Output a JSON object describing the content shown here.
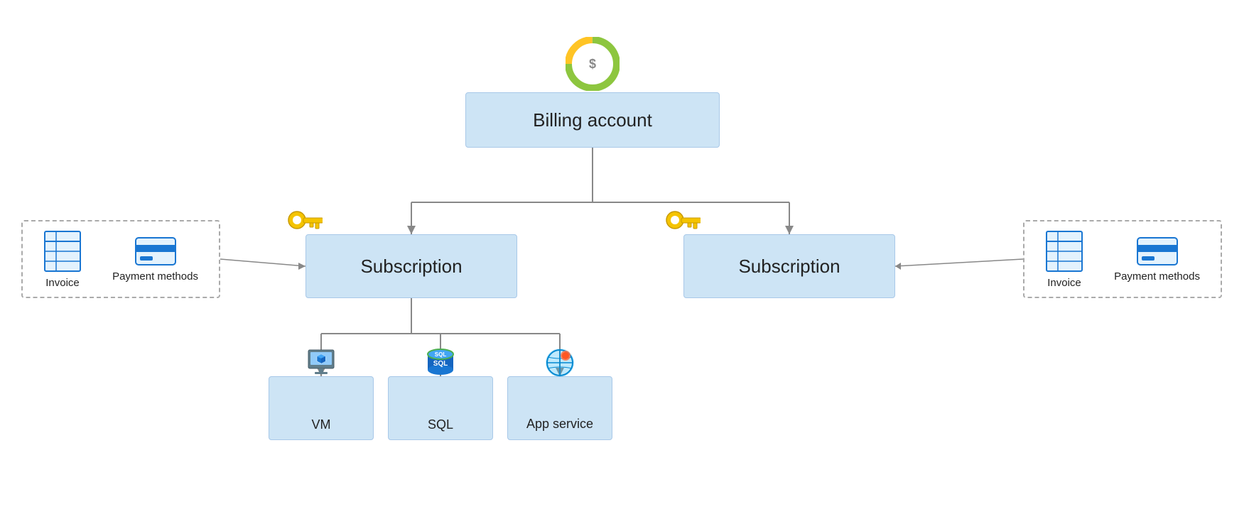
{
  "billing": {
    "label": "Billing account",
    "icon_label": "billing-donut-icon"
  },
  "subscriptions": [
    {
      "label": "Subscription",
      "id": "sub-left"
    },
    {
      "label": "Subscription",
      "id": "sub-right"
    }
  ],
  "resources": [
    {
      "label": "VM",
      "id": "res-vm"
    },
    {
      "label": "SQL",
      "id": "res-sql"
    },
    {
      "label": "App service",
      "id": "res-app"
    }
  ],
  "left_panel": {
    "invoice_label": "Invoice",
    "payment_label": "Payment methods"
  },
  "right_panel": {
    "invoice_label": "Invoice",
    "payment_label": "Payment methods"
  }
}
